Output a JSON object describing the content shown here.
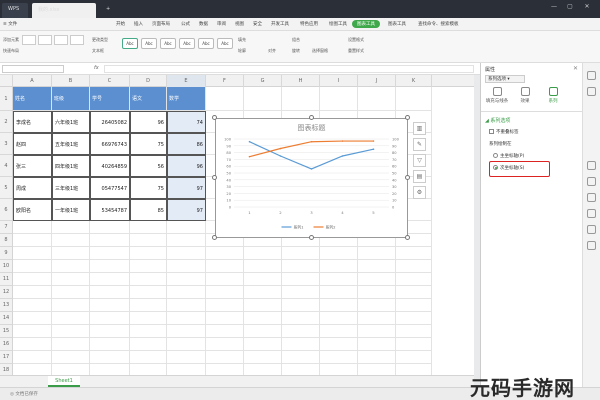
{
  "titlebar": {
    "tabs": [
      "WPS",
      "我的.xlsx"
    ],
    "add": "+",
    "window_buttons": [
      "—",
      "▢",
      "✕"
    ]
  },
  "menubar": {
    "file": "≡ 文件",
    "items": [
      "开始",
      "插入",
      "页面布局",
      "公式",
      "数据",
      "审阅",
      "视图",
      "安全",
      "开发工具",
      "特色应用",
      "绘图工具",
      "图表工具",
      "图表工具",
      "查找命令、搜索模板"
    ]
  },
  "ribbon": {
    "add_element": "添加元素",
    "quick_layout": "快速布局",
    "change_type": "更改类型",
    "chart_elements": "图表元素",
    "text_box": "文本框",
    "styles": [
      "Abc",
      "Abc",
      "Abc",
      "Abc",
      "Abc",
      "Abc"
    ],
    "fill": "填充",
    "outline": "轮廓",
    "align": "对齐",
    "group": "组合",
    "rotate": "旋转",
    "select_pane": "选择窗格",
    "set_format": "设置格式",
    "reset_style": "重置样式"
  },
  "formulabar": {
    "fx": "fx"
  },
  "sheet": {
    "columns": [
      "A",
      "B",
      "C",
      "D",
      "E",
      "F",
      "G",
      "H",
      "I",
      "J",
      "K"
    ],
    "rows": [
      "1",
      "2",
      "3",
      "4",
      "5",
      "6",
      "7",
      "8",
      "9",
      "10",
      "11",
      "12",
      "13",
      "14",
      "15",
      "16",
      "17",
      "18",
      "19"
    ],
    "table": [
      [
        "姓名",
        "班级",
        "学号",
        "语文",
        "数学"
      ],
      [
        "李成名",
        "六年级1班",
        "26405082",
        "96",
        "74"
      ],
      [
        "赵四",
        "五年级1班",
        "66976743",
        "75",
        "86"
      ],
      [
        "张三",
        "四年级1班",
        "40264859",
        "56",
        "96"
      ],
      [
        "周成",
        "三年级1班",
        "05477547",
        "75",
        "97"
      ],
      [
        "欧阳名",
        "一年级1班",
        "53454787",
        "85",
        "97"
      ]
    ],
    "sheet_tab": "Sheet1",
    "status": "◎ 文档已保存"
  },
  "chart_data": {
    "type": "line",
    "title": "图表标题",
    "x": [
      "1",
      "2",
      "3",
      "4",
      "5"
    ],
    "series": [
      {
        "name": "系列1",
        "values": [
          96,
          75,
          56,
          75,
          85
        ],
        "axis": "primary",
        "color": "#5b9bd5"
      },
      {
        "name": "系列2",
        "values": [
          74,
          86,
          96,
          97,
          97
        ],
        "axis": "secondary",
        "color": "#ed7d31"
      }
    ],
    "y_ticks": [
      "0",
      "10",
      "20",
      "30",
      "40",
      "50",
      "60",
      "70",
      "80",
      "90",
      "100"
    ],
    "y2_ticks": [
      "0",
      "10",
      "20",
      "30",
      "40",
      "50",
      "60",
      "70",
      "80",
      "90",
      "100"
    ],
    "ylim": [
      0,
      100
    ],
    "y2lim": [
      0,
      100
    ],
    "legend_position": "bottom",
    "grid": true
  },
  "pane": {
    "title": "属性",
    "close": "✕",
    "dropdown": "系列选项 ▾",
    "tabs": [
      "填充与线条",
      "效果",
      "系列"
    ],
    "section": "◢ 系列选项",
    "no_label": "不重叠标签",
    "plot_on": "系列绘制在",
    "primary": "主坐标轴(P)",
    "secondary": "次坐标轴(S)"
  },
  "watermark": "元码手游网"
}
